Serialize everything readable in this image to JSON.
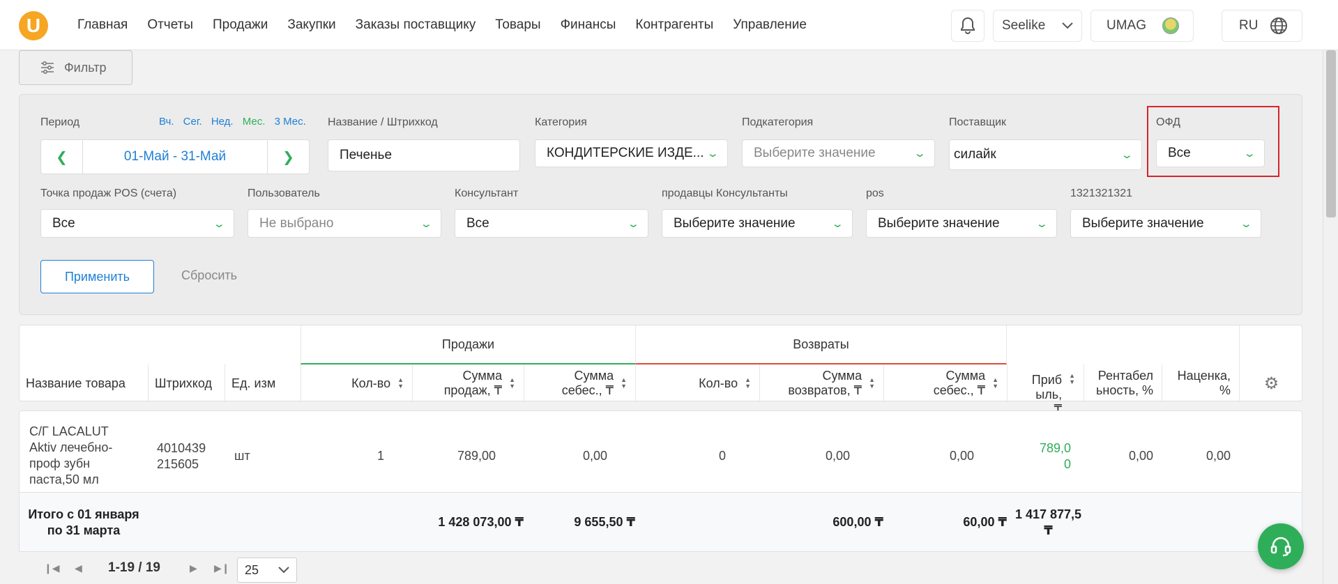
{
  "brand": {
    "logo_letter": "U",
    "accent": "#f6a623"
  },
  "nav": {
    "items": [
      "Главная",
      "Отчеты",
      "Продажи",
      "Закупки",
      "Заказы поставщику",
      "Товары",
      "Финансы",
      "Контрагенты",
      "Управление"
    ]
  },
  "header": {
    "account": "Seelike",
    "store": "UMAG",
    "language": "RU"
  },
  "filter_button": {
    "label": "Фильтр"
  },
  "filters": {
    "period": {
      "label": "Период",
      "quick_links": [
        {
          "label": "Вч.",
          "color": "#1e7fd6"
        },
        {
          "label": "Сег.",
          "color": "#1e7fd6"
        },
        {
          "label": "Нед.",
          "color": "#1e7fd6"
        },
        {
          "label": "Мес.",
          "color": "#2fae5a"
        },
        {
          "label": "3 Мес.",
          "color": "#1e7fd6"
        }
      ],
      "range": "01-Май  -  31-Май"
    },
    "name_barcode": {
      "label": "Название / Штрихкод",
      "value": "Печенье"
    },
    "category": {
      "label": "Категория",
      "value": "КОНДИТЕРСКИЕ ИЗДЕ..."
    },
    "subcategory": {
      "label": "Подкатегория",
      "placeholder": "Выберите значение"
    },
    "supplier": {
      "label": "Поставщик",
      "value": "силайк"
    },
    "ofd": {
      "label": "ОФД",
      "value": "Все"
    },
    "pos_point": {
      "label": "Точка продаж POS (счета)",
      "value": "Все"
    },
    "user": {
      "label": "Пользователь",
      "placeholder": "Не выбрано"
    },
    "consultant": {
      "label": "Консультант",
      "value": "Все"
    },
    "sellers_consultants": {
      "label": "продавцы Консультанты",
      "value": "Выберите значение"
    },
    "pos": {
      "label": "pos",
      "value": "Выберите значение"
    },
    "custom_field": {
      "label": "1321321321",
      "value": "Выберите значение"
    },
    "apply": "Применить",
    "reset": "Сбросить"
  },
  "table": {
    "groups": {
      "sales": "Продажи",
      "returns": "Возвраты"
    },
    "columns": {
      "name": "Название товара",
      "barcode": "Штрихкод",
      "unit": "Ед. изм",
      "sales_qty": "Кол-во",
      "sales_sum_a": "Сумма",
      "sales_sum_b": "продаж, ₸",
      "sales_cost_a": "Сумма",
      "sales_cost_b": "себес., ₸",
      "ret_qty": "Кол-во",
      "ret_sum_a": "Сумма",
      "ret_sum_b": "возвратов, ₸",
      "ret_cost_a": "Сумма",
      "ret_cost_b": "себес., ₸",
      "profit_a": "Приб",
      "profit_b": "ыль,",
      "profit_c": "₸",
      "profitability_a": "Рентабел",
      "profitability_b": "ьность, %",
      "markup_a": "Наценка,",
      "markup_b": "%"
    },
    "rows": [
      {
        "name_lines": [
          "С/Г LACALUT",
          "Aktiv лечебно-",
          "проф зубн",
          "паста,50 мл"
        ],
        "barcode_lines": [
          "4010439",
          "215605"
        ],
        "unit": "шт",
        "sales_qty": "1",
        "sales_sum": "789,00",
        "sales_cost": "0,00",
        "ret_qty": "0",
        "ret_sum": "0,00",
        "ret_cost": "0,00",
        "profit_a": "789,0",
        "profit_b": "0",
        "profitability": "0,00",
        "markup": "0,00"
      }
    ],
    "total": {
      "label_a": "Итого с 01 января",
      "label_b": "по 31 марта",
      "sales_sum": "1 428 073,00 ₸",
      "sales_cost": "9 655,50 ₸",
      "ret_sum": "600,00 ₸",
      "ret_cost": "60,00 ₸",
      "profit_a": "1 417 877,5",
      "profit_b": "₸"
    }
  },
  "pagination": {
    "info": "1-19 / 19",
    "page_size": "25"
  }
}
